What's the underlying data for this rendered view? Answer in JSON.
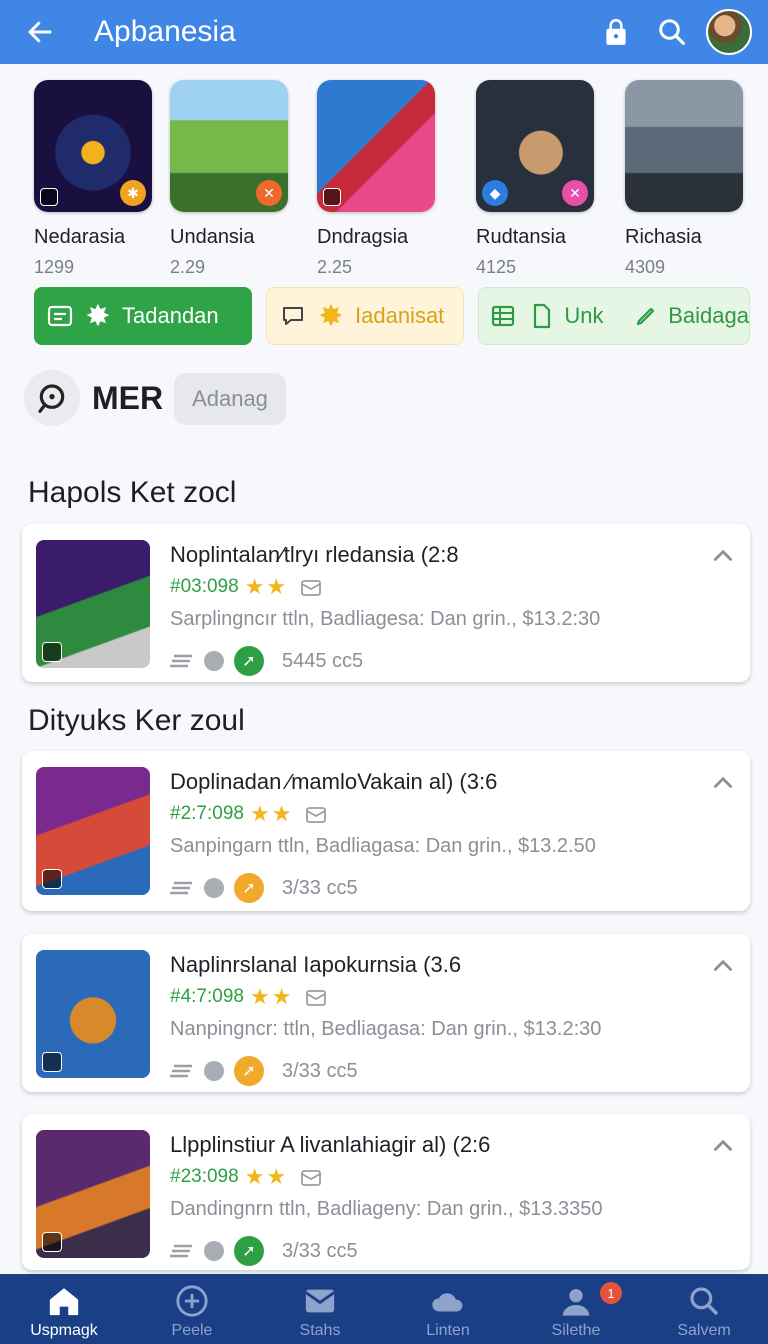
{
  "header": {
    "title": "Apbanesia"
  },
  "featured": [
    {
      "name": "Nedarasia",
      "number": "1299",
      "colors": [
        "#1a1040",
        "#f2b21c"
      ],
      "badge_color": "#f1a21f"
    },
    {
      "name": "Undansia",
      "number": "2.29",
      "colors": [
        "#76b84a",
        "#3a6f2c"
      ],
      "badge_color": "#ef6a2a"
    },
    {
      "name": "Dndragsia",
      "number": "2.25",
      "colors": [
        "#2d7ad0",
        "#e84a8a"
      ],
      "badge_color": ""
    },
    {
      "name": "Rudtansia",
      "number": "4125",
      "colors": [
        "#27303c",
        "#a8743c"
      ],
      "badge_color": "#e84fa7"
    },
    {
      "name": "Richasia",
      "number": "4309",
      "colors": [
        "#5a6877",
        "#2b3138"
      ],
      "badge_color": ""
    }
  ],
  "chips": {
    "green": "Tadandan",
    "yellow": "Iadanisat",
    "lgreen_a": "Unk",
    "lgreen_b": "Baidaga"
  },
  "mer": {
    "label": "MER",
    "pill": "Adanag"
  },
  "sections": {
    "first": "Hapols Ket zocl",
    "second": "Dityuks Ker zoul"
  },
  "cards": [
    {
      "title": "Noplintalan∕tlryı rledansia (2:8",
      "rating": "#03:098",
      "desc": "Sarplingncır ttln, Badliagesa: Dan grin., $13.2:30",
      "count": "5445 cc5",
      "go_color": "#2ea043",
      "thumb_colors": [
        "#3a1c6b",
        "#2e8a3e"
      ]
    },
    {
      "title": "Doplinadan ∕mamloVakain al) (3:6",
      "rating": "#2:7:098",
      "desc": "Sanpingarn ttln, Badliagasa: Dan grin., $13.2.50",
      "count": "3/33 cc5",
      "go_color": "#f0a92a",
      "thumb_colors": [
        "#7a2a8e",
        "#d64a3a"
      ]
    },
    {
      "title": "Naplinrslanal Iapokurnsia (3.6",
      "rating": "#4:7:098",
      "desc": "Nanpingncr: ttln, Bedliagasa: Dan grin., $13.2:30",
      "count": "3/33 cc5",
      "go_color": "#f0a92a",
      "thumb_colors": [
        "#2a6ab8",
        "#d88a2a"
      ]
    },
    {
      "title": "Llpplinstiur A livanlahiagir al) (2:6",
      "rating": "#23:098",
      "desc": "Dandingnrn ttln, Badliageny: Dan grin., $13.3350",
      "count": "3/33 cc5",
      "go_color": "#2ea043",
      "thumb_colors": [
        "#5a2a6e",
        "#d8782a"
      ]
    }
  ],
  "nav": [
    {
      "label": "Uspmagk"
    },
    {
      "label": "Peele"
    },
    {
      "label": "Stahs"
    },
    {
      "label": "Linten"
    },
    {
      "label": "Silethe",
      "badge": "1"
    },
    {
      "label": "Salvem"
    }
  ]
}
